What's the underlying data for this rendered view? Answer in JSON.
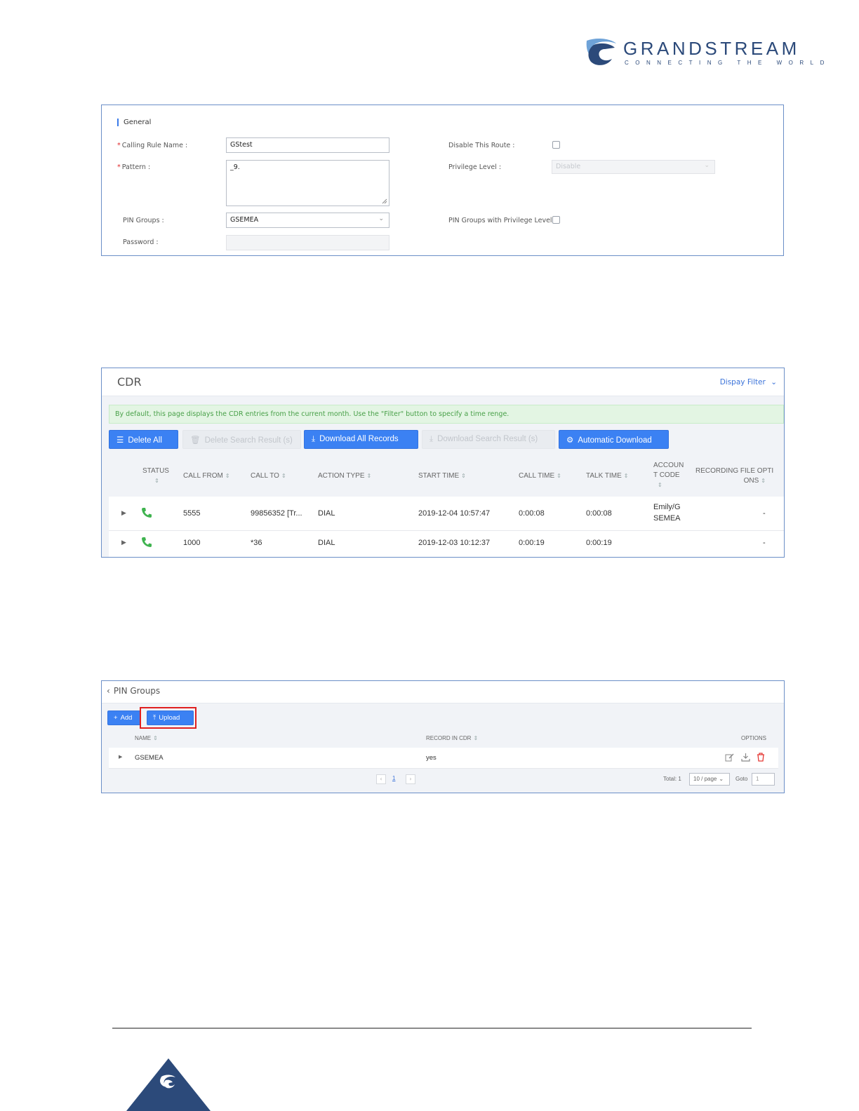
{
  "brand": {
    "name": "GRANDSTREAM",
    "tagline": "CONNECTING THE WORLD",
    "colors": {
      "navy": "#2c4a7a",
      "light": "#6fa3d8"
    }
  },
  "general_form": {
    "section_title": "General",
    "fields": {
      "calling_rule_name": {
        "label": "Calling Rule Name :",
        "value": "GStest"
      },
      "pattern": {
        "label": "Pattern :",
        "value": "_9."
      },
      "pin_groups": {
        "label": "PIN Groups :",
        "value": "GSEMEA"
      },
      "password": {
        "label": "Password :",
        "value": ""
      },
      "disable_route": {
        "label": "Disable This Route :"
      },
      "privilege_level": {
        "label": "Privilege Level :",
        "value": "Disable"
      },
      "pin_groups_privilege": {
        "label": "PIN Groups with Privilege Level :"
      }
    }
  },
  "cdr": {
    "title": "CDR",
    "display_filter": "Dispay Filter",
    "notice": "By default, this page displays the CDR entries from the current month. Use the \"Filter\" button to specify a time renge.",
    "buttons": {
      "delete_all": "Delete All",
      "delete_search": "Delete Search Result (s)",
      "download_all": "Download All Records",
      "download_search": "Download Search Result (s)",
      "auto_download": "Automatic Download"
    },
    "columns": {
      "status": "STATUS",
      "call_from": "CALL FROM",
      "call_to": "CALL TO",
      "action_type": "ACTION TYPE",
      "start_time": "START TIME",
      "call_time": "CALL TIME",
      "talk_time": "TALK TIME",
      "account_code_1": "ACCOUN",
      "account_code_2": "T CODE",
      "rec_options_1": "RECORDING FILE OPTI",
      "rec_options_2": "ONS"
    },
    "rows": [
      {
        "call_from": "5555",
        "call_to": "99856352 [Tr...",
        "action": "DIAL",
        "start": "2019-12-04 10:57:47",
        "call_time": "0:00:08",
        "talk_time": "0:00:08",
        "acct_1": "Emily/G",
        "acct_2": "SEMEA",
        "options": "-"
      },
      {
        "call_from": "1000",
        "call_to": "*36",
        "action": "DIAL",
        "start": "2019-12-03 10:12:37",
        "call_time": "0:00:19",
        "talk_time": "0:00:19",
        "acct_1": "",
        "acct_2": "",
        "options": "-"
      }
    ],
    "status_color": "#3fb34f"
  },
  "pin_groups": {
    "title": "PIN Groups",
    "buttons": {
      "add": "Add",
      "upload": "Upload"
    },
    "columns": {
      "name": "NAME",
      "record_in_cdr": "RECORD IN CDR",
      "options": "OPTIONS"
    },
    "rows": [
      {
        "name": "GSEMEA",
        "record_in_cdr": "yes"
      }
    ],
    "pagination": {
      "page": "1",
      "total": "Total: 1",
      "page_size": "10 / page",
      "goto_label": "Goto",
      "goto_value": "1"
    }
  }
}
